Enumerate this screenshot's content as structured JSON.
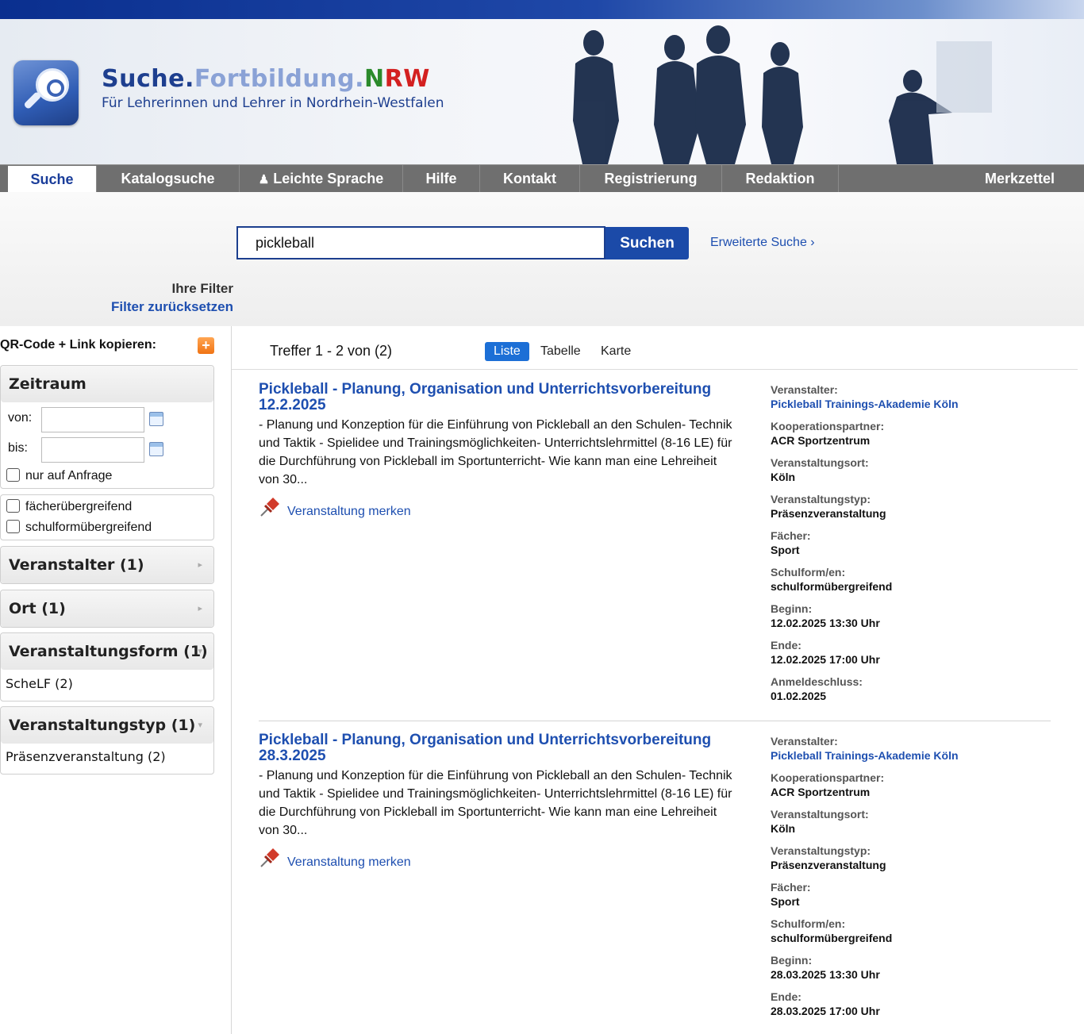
{
  "header": {
    "brand": {
      "part1": "Suche.",
      "part2": "Fortbildung.",
      "part3": "N",
      "part4": "RW"
    },
    "tagline": "Für Lehrerinnen und Lehrer in Nordrhein-Westfalen"
  },
  "nav": {
    "items": [
      {
        "label": "Suche"
      },
      {
        "label": "Katalogsuche"
      },
      {
        "label": "Leichte Sprache"
      },
      {
        "label": "Hilfe"
      },
      {
        "label": "Kontakt"
      },
      {
        "label": "Registrierung"
      },
      {
        "label": "Redaktion"
      },
      {
        "label": "Merkzettel"
      }
    ],
    "active": "Suche"
  },
  "search": {
    "value": "pickleball",
    "button": "Suchen",
    "advanced": "Erweiterte Suche ›"
  },
  "filters": {
    "title": "Ihre Filter",
    "reset": "Filter zurücksetzen",
    "qr_label": "QR-Code + Link kopieren:",
    "zeitraum": {
      "title": "Zeitraum",
      "von": "von:",
      "bis": "bis:",
      "on_request": "nur auf Anfrage"
    },
    "cross": {
      "faecher": "fächerübergreifend",
      "schulform": "schulformübergreifend"
    },
    "facets": {
      "veranstalter": "Veranstalter (1)",
      "ort": "Ort (1)",
      "form": "Veranstaltungsform (1)",
      "form_item": "ScheLF (2)",
      "typ": "Veranstaltungstyp (1)",
      "typ_item": "Präsenzveranstaltung (2)"
    }
  },
  "results": {
    "hits": "Treffer 1 - 2 von (2)",
    "views": [
      "Liste",
      "Tabelle",
      "Karte"
    ],
    "active_view": "Liste",
    "remember_label": "Veranstaltung merken",
    "items": [
      {
        "title": "Pickleball - Planung, Organisation und Unterrichtsvorbereitung 12.2.2025",
        "description": "- Planung und Konzeption für die Einführung von Pickleball an den Schulen- Technik und Taktik - Spielidee und Trainingsmöglichkeiten- Unterrichtslehrmittel (8-16 LE)  für die Durchführung von Pickleball im Sportunterricht- Wie kann man eine Lehreiheit von 30...",
        "meta": {
          "veranstalter_label": "Veranstalter:",
          "veranstalter": "Pickleball Trainings-Akademie Köln",
          "partner_label": "Kooperationspartner:",
          "partner": "ACR Sportzentrum",
          "ort_label": "Veranstaltungsort:",
          "ort": "Köln",
          "typ_label": "Veranstaltungstyp:",
          "typ": "Präsenzveranstaltung",
          "faecher_label": "Fächer:",
          "faecher": "Sport",
          "schulform_label": "Schulform/en:",
          "schulform": "schulformübergreifend",
          "beginn_label": "Beginn:",
          "beginn": "12.02.2025  13:30  Uhr",
          "ende_label": "Ende:",
          "ende": "12.02.2025  17:00  Uhr",
          "anmeldeschluss_label": "Anmeldeschluss:",
          "anmeldeschluss": "01.02.2025"
        }
      },
      {
        "title": "Pickleball - Planung, Organisation und Unterrichtsvorbereitung 28.3.2025",
        "description": "- Planung und Konzeption für die Einführung von Pickleball an den Schulen- Technik und Taktik - Spielidee und Trainingsmöglichkeiten- Unterrichtslehrmittel (8-16 LE)  für die Durchführung von Pickleball im Sportunterricht- Wie kann man eine Lehreiheit von 30...",
        "meta": {
          "veranstalter_label": "Veranstalter:",
          "veranstalter": "Pickleball Trainings-Akademie Köln",
          "partner_label": "Kooperationspartner:",
          "partner": "ACR Sportzentrum",
          "ort_label": "Veranstaltungsort:",
          "ort": "Köln",
          "typ_label": "Veranstaltungstyp:",
          "typ": "Präsenzveranstaltung",
          "faecher_label": "Fächer:",
          "faecher": "Sport",
          "schulform_label": "Schulform/en:",
          "schulform": "schulformübergreifend",
          "beginn_label": "Beginn:",
          "beginn": "28.03.2025  13:30  Uhr",
          "ende_label": "Ende:",
          "ende": "28.03.2025  17:00  Uhr"
        }
      }
    ]
  }
}
